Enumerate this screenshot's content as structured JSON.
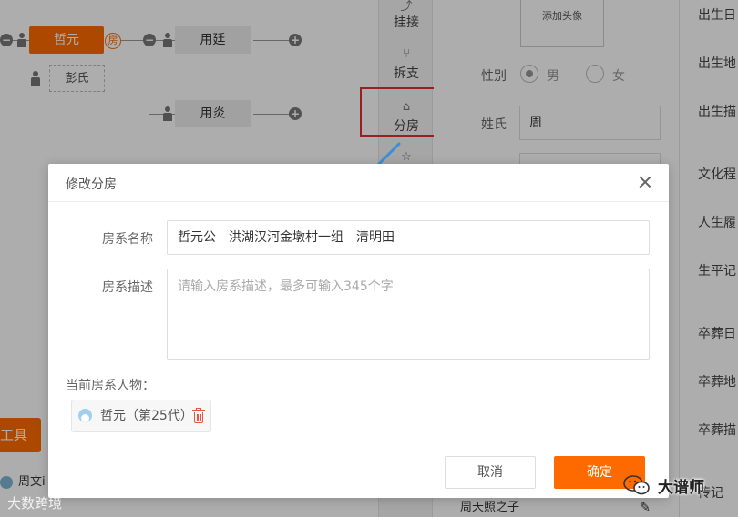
{
  "tree": {
    "root_name": "哲元",
    "fang_mark": "房",
    "spouse_name": "彭氏",
    "child1_name": "用廷",
    "child2_name": "用炎"
  },
  "toolbar": {
    "items": [
      {
        "label": "挂接",
        "icon": "link-icon"
      },
      {
        "label": "拆支",
        "icon": "split-icon"
      },
      {
        "label": "分房",
        "icon": "home-icon"
      }
    ]
  },
  "profile_form": {
    "avatar_button": "添加头像",
    "gender_label": "性别",
    "gender_options": [
      "男",
      "女"
    ],
    "surname_label": "姓氏",
    "surname_value": "周"
  },
  "right_panel": {
    "labels": [
      "出生日",
      "出生地",
      "出生描",
      "文化程",
      "人生履",
      "生平记",
      "卒葬日",
      "卒葬地",
      "卒葬描",
      "传记"
    ]
  },
  "left_bottom": {
    "tool_button": "工具",
    "list_item": "周文i"
  },
  "bottom_strip": {
    "text": "周天照之子"
  },
  "modal": {
    "title": "修改分房",
    "name_label": "房系名称",
    "name_value": "哲元公　洪湖汉河金墩村一组　清明田",
    "desc_label": "房系描述",
    "desc_placeholder": "请输入房系描述，最多可输入345个字",
    "current_label": "当前房系人物：",
    "member": "哲元（第25代）",
    "cancel": "取消",
    "confirm": "确定"
  },
  "watermark": {
    "left": "大数跨境",
    "right": "大谱师"
  },
  "colors": {
    "accent": "#ff6a00",
    "highlight": "#e03030",
    "arrow": "#3a8fd8"
  }
}
